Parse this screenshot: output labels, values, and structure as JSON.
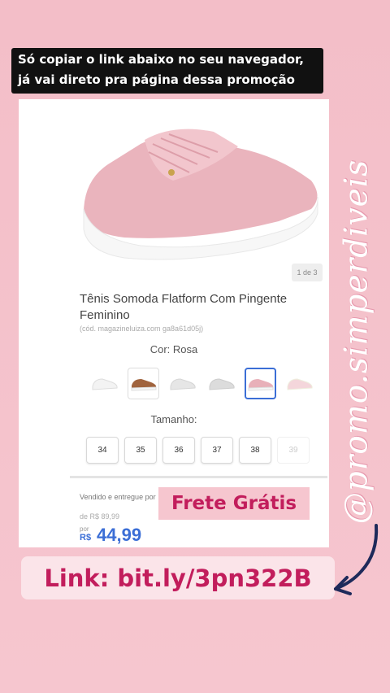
{
  "caption": {
    "line1": "Só copiar o link abaixo no seu navegador,",
    "line2": "já vai direto pra página dessa promoção"
  },
  "product": {
    "image_pager": "1 de 3",
    "title": "Tênis Somoda Flatform Com Pingente Feminino",
    "code": "(cód. magazineluiza.com ga8a61d05j)",
    "color_label": "Cor: Rosa",
    "size_label": "Tamanho:",
    "sizes": [
      "34",
      "35",
      "36",
      "37",
      "38",
      "39"
    ],
    "seller": "Vendido e entregue por",
    "old_price": "de R$ 89,99",
    "por": "por",
    "currency": "R$",
    "price": "44,99"
  },
  "promo": {
    "frete": "Frete Grátis",
    "link": "Link: bit.ly/3pn322B"
  },
  "handle": "@promo.simperdiveis",
  "colors": {
    "background": "#f4c0ca",
    "accent": "#c21d5c",
    "price": "#3b6ed6"
  }
}
